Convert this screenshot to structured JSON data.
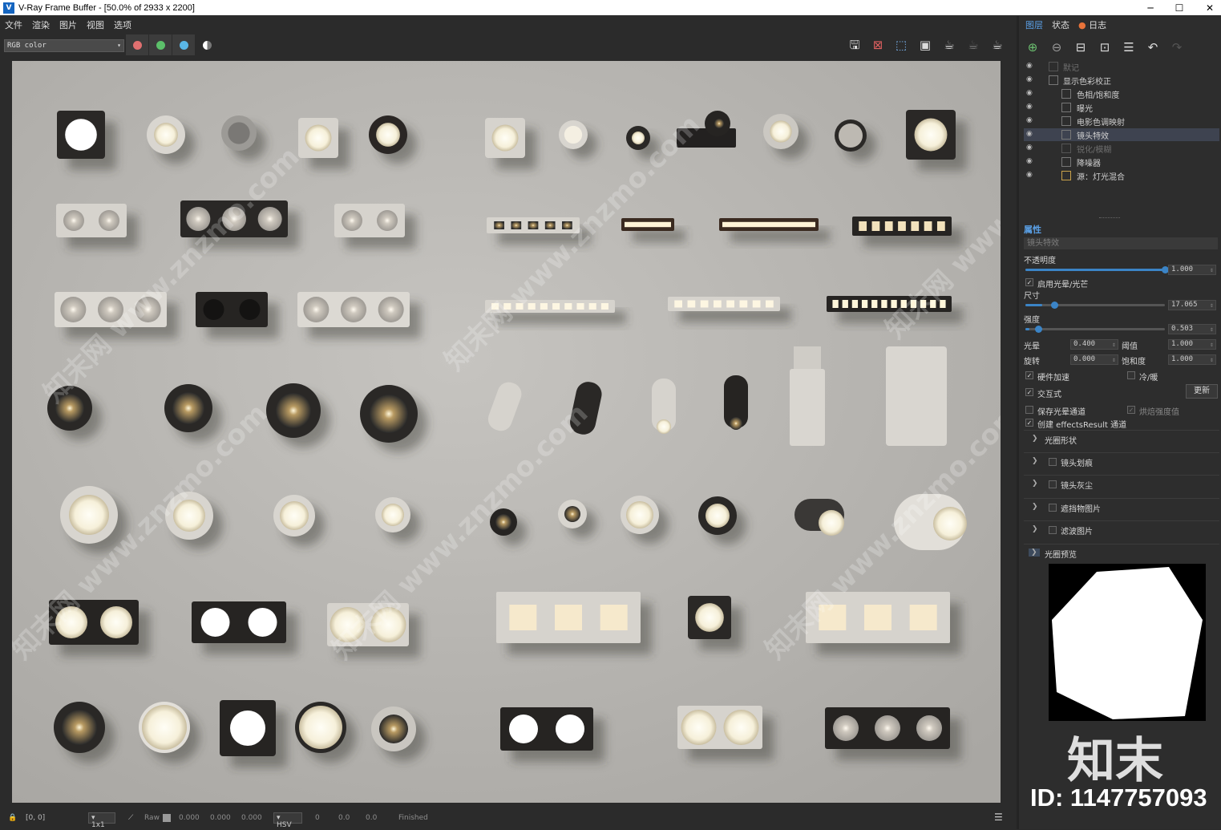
{
  "window": {
    "title": "V-Ray Frame Buffer - [50.0% of 2933 x 2200]",
    "logo": "V"
  },
  "window_controls": {
    "minimize": "─",
    "maximize": "☐",
    "close": "✕"
  },
  "menu": [
    "文件",
    "渲染",
    "图片",
    "视图",
    "选项"
  ],
  "toolbar": {
    "channel": "RGB color",
    "channel_buttons": [
      {
        "name": "red-channel",
        "color": "#e07070"
      },
      {
        "name": "green-channel",
        "color": "#5cc06a"
      },
      {
        "name": "blue-channel",
        "color": "#5ab6e6"
      },
      {
        "name": "alpha-channel",
        "color": "#ffffff"
      }
    ],
    "icons": [
      "save-icon",
      "clear-icon",
      "region-icon",
      "follow-mouse-icon",
      "render-icon",
      "render-interactive-icon",
      "stop-render-icon"
    ]
  },
  "statusbar": {
    "coords": "[0, 0]",
    "zoom": "1x1",
    "raw_label": "Raw",
    "rgb": [
      "0.000",
      "0.000",
      "0.000"
    ],
    "colorspace": "HSV",
    "hsv": [
      "0",
      "0.0",
      "0.0"
    ],
    "status": "Finished"
  },
  "panel": {
    "tabs": [
      "图层",
      "状态",
      "日志"
    ],
    "active_tab": "图层",
    "log_dot_color": "#e8733a",
    "layers": [
      {
        "label": "默记",
        "enabled": false,
        "indent": 0
      },
      {
        "label": "显示色彩校正",
        "enabled": true,
        "indent": 0
      },
      {
        "label": "色相/饱和度",
        "enabled": true,
        "indent": 1
      },
      {
        "label": "曝光",
        "enabled": true,
        "indent": 1
      },
      {
        "label": "电影色调映射",
        "enabled": true,
        "indent": 1
      },
      {
        "label": "镜头特效",
        "enabled": true,
        "indent": 1,
        "selected": true
      },
      {
        "label": "锐化/模糊",
        "enabled": false,
        "indent": 1
      },
      {
        "label": "降噪器",
        "enabled": true,
        "indent": 1
      },
      {
        "label": "源：灯光混合",
        "enabled": true,
        "indent": 1
      }
    ],
    "properties": {
      "header": "属性",
      "layer_name": "镜头特效",
      "opacity_label": "不透明度",
      "opacity_value": "1.000",
      "opacity_level": 1.0,
      "bloom_glare_label": "启用光晕/光芒",
      "size_label": "尺寸",
      "size_value": "17.065",
      "size_level": 0.12,
      "intensity_label": "强度",
      "intensity_value": "0.503",
      "intensity_level": 0.03,
      "bloom_label": "光晕",
      "bloom_value": "0.400",
      "threshold_label": "阈值",
      "threshold_value": "1.000",
      "rotation_label": "旋转",
      "rotation_value": "0.000",
      "saturation_label": "饱和度",
      "saturation_value": "1.000",
      "hw_accel_label": "硬件加速",
      "cold_warm_label": "冷/暖",
      "interactive_label": "交互式",
      "update_button": "更新",
      "save_channel_label": "保存光晕通道",
      "bake_label": "烘焙强度值",
      "create_channel_label": "创建 effectsResult 通道",
      "rollouts": [
        "光圈形状",
        "镜头划痕",
        "镜头灰尘",
        "遮挡物图片",
        "滤波图片"
      ],
      "aperture_preview_label": "光圈预览"
    }
  },
  "watermark": {
    "brand": "知末",
    "id": "ID: 1147757093",
    "diag_text": "知末网 www.znzmo.com"
  }
}
